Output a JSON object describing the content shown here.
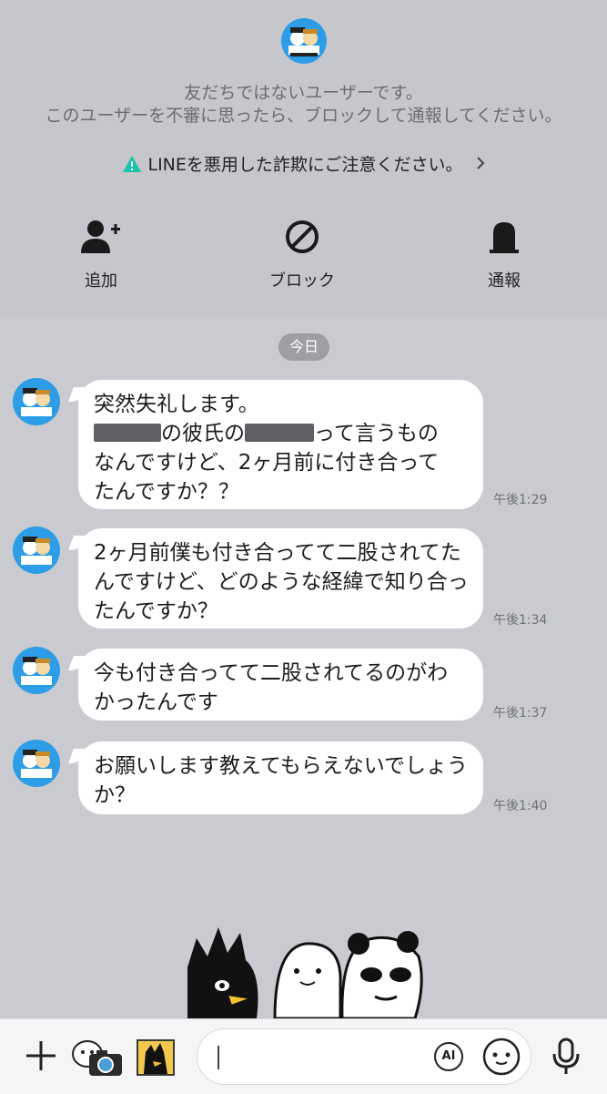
{
  "notice": {
    "line1": "友だちではないユーザーです。",
    "line2": "このユーザーを不審に思ったら、ブロックして通報してください。",
    "warning": "LINEを悪用した詐欺にご注意ください。"
  },
  "actions": {
    "add": "追加",
    "block": "ブロック",
    "report": "通報"
  },
  "date_label": "今日",
  "messages": [
    {
      "line1": "突然失礼します。",
      "line2_part1": "の彼氏の",
      "line2_part2": "って言うもの",
      "line3": "なんですけど、2ヶ月前に付き合って",
      "line4": "たんですか？？",
      "time": "午後1:29"
    },
    {
      "text": "2ヶ月前僕も付き合ってて二股されてたんですけど、どのような経緯で知り合ったんですか？",
      "time": "午後1:34"
    },
    {
      "text": "今も付き合ってて二股されてるのがわかったんです",
      "time": "午後1:37"
    },
    {
      "text": "お願いします教えてもらえないでしょうか？",
      "time": "午後1:40"
    }
  ],
  "input": {
    "ai_label": "AI"
  },
  "colors": {
    "warning": "#18c3a8",
    "avatar": "#2c9de6",
    "bubble": "#ffffff",
    "background": "#c9cbd0"
  }
}
